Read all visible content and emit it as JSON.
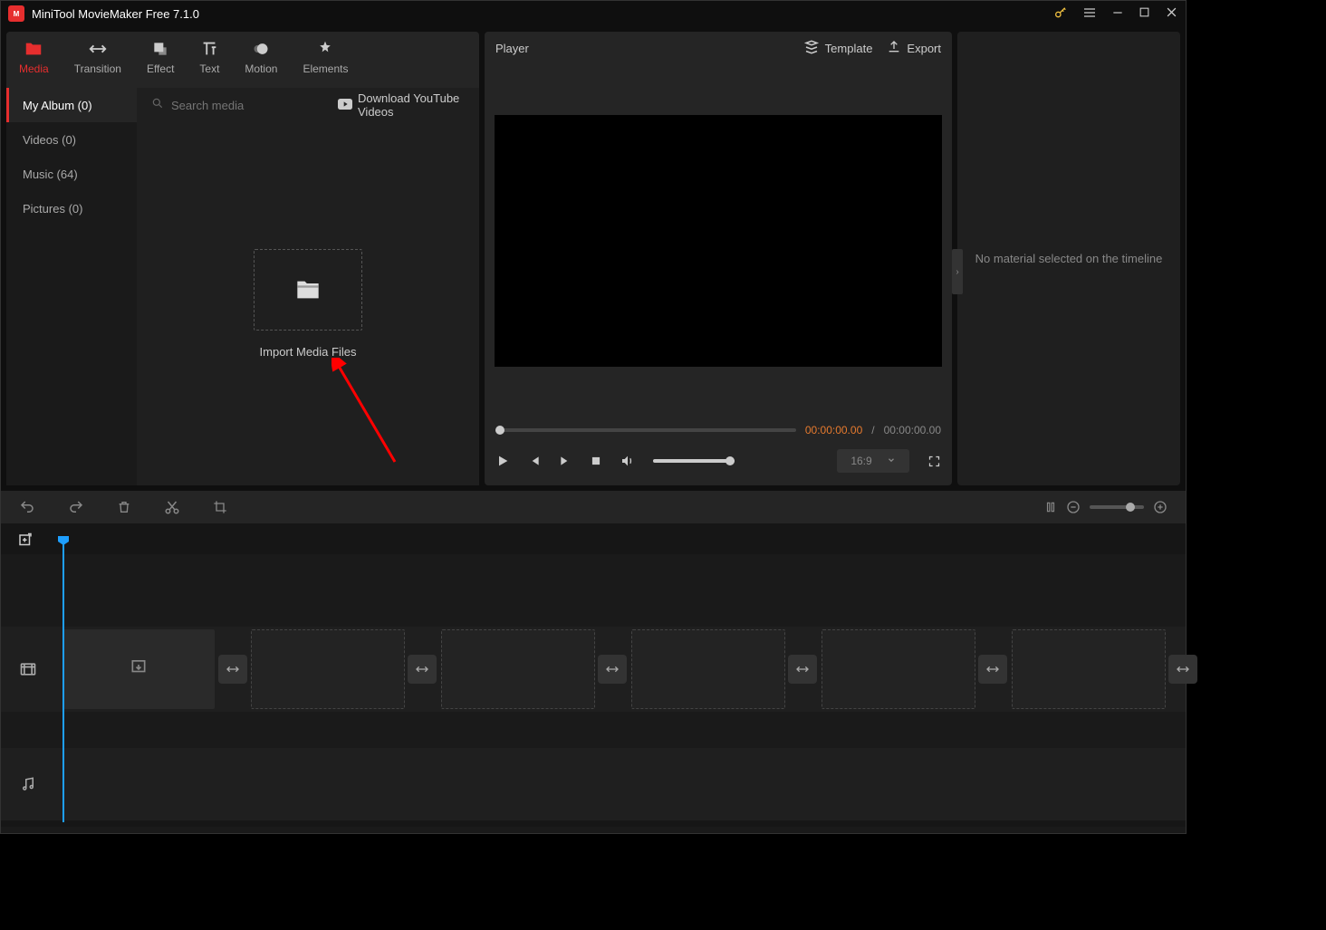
{
  "title": "MiniTool MovieMaker Free 7.1.0",
  "topTabs": {
    "media": "Media",
    "transition": "Transition",
    "effect": "Effect",
    "text": "Text",
    "motion": "Motion",
    "elements": "Elements"
  },
  "categories": {
    "myAlbum": "My Album (0)",
    "videos": "Videos (0)",
    "music": "Music (64)",
    "pictures": "Pictures (0)"
  },
  "search": {
    "placeholder": "Search media"
  },
  "downloadYT": "Download YouTube Videos",
  "importLabel": "Import Media Files",
  "player": {
    "title": "Player",
    "template": "Template",
    "export": "Export",
    "currentTime": "00:00:00.00",
    "sep": "/",
    "totalTime": "00:00:00.00",
    "ratio": "16:9"
  },
  "inspector": {
    "empty": "No material selected on the timeline"
  }
}
